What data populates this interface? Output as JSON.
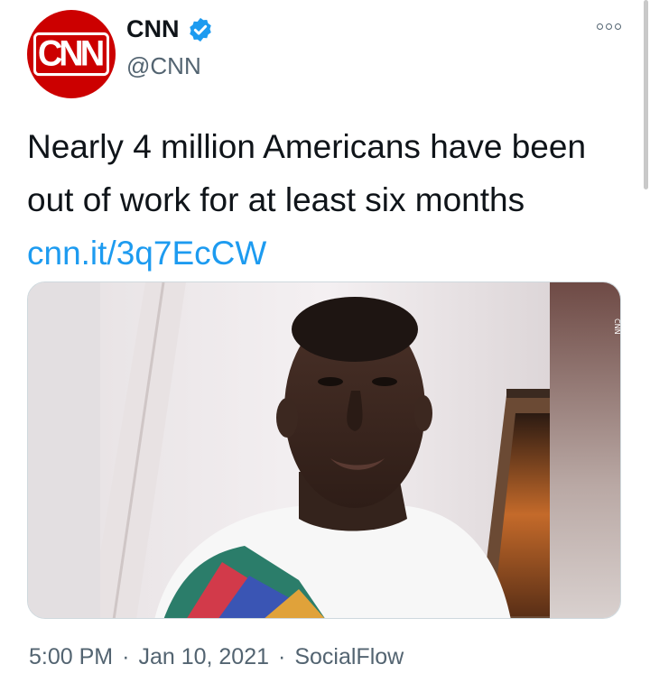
{
  "account": {
    "avatar_text": "CNN",
    "display_name": "CNN",
    "handle": "@CNN"
  },
  "tweet": {
    "text": "Nearly 4 million Americans have been out of work for at least six months",
    "link": "cnn.it/3q7EcCW",
    "time": "5:00 PM",
    "date": "Jan 10, 2021",
    "separator": "·",
    "source": "SocialFlow"
  },
  "colors": {
    "brand_red": "#cc0000",
    "link_blue": "#1d9bf0",
    "verified_blue": "#1d9bf0",
    "secondary_text": "#536471"
  },
  "icons": {
    "verified": "verified-badge-icon",
    "more": "more-options-icon"
  }
}
